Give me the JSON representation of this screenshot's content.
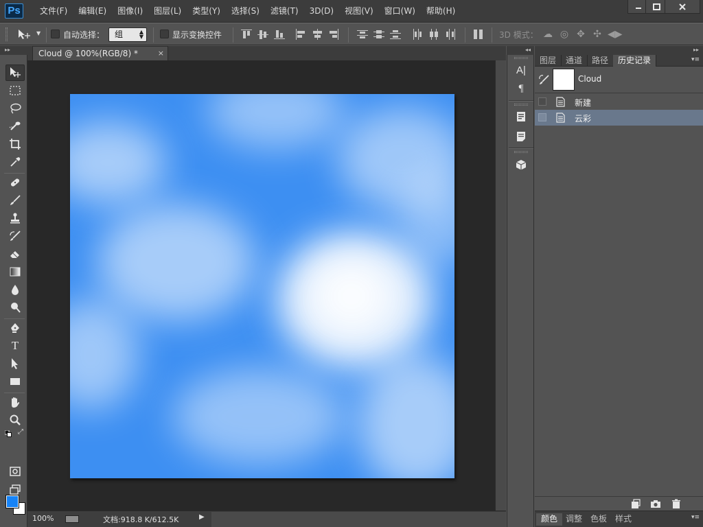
{
  "app": {
    "logo": "Ps",
    "menu": [
      "文件(F)",
      "编辑(E)",
      "图像(I)",
      "图层(L)",
      "类型(Y)",
      "选择(S)",
      "滤镜(T)",
      "3D(D)",
      "视图(V)",
      "窗口(W)",
      "帮助(H)"
    ],
    "window_controls": [
      "minimize-icon",
      "maximize-icon",
      "close-icon"
    ]
  },
  "options_bar": {
    "tool_icon": "move-tool-icon",
    "auto_select_label": "自动选择：",
    "auto_select_checked": false,
    "auto_select_target": "组",
    "show_transform_label": "显示变换控件",
    "show_transform_checked": false,
    "mode_3d_label": "3D 模式："
  },
  "document": {
    "tab_title": "Cloud @ 100%(RGB/8) *",
    "close_glyph": "×",
    "canvas_content": "cloud-texture",
    "colors": {
      "sky": "#3d8ff2",
      "cloud": "#ffffff",
      "pasteboard": "#282828"
    }
  },
  "status": {
    "zoom": "100%",
    "doc_info": "文档:918.8 K/612.5K",
    "arrow": "▶"
  },
  "tools": {
    "active": "move-tool",
    "foreground_color": "#1683f7",
    "background_color": "#ffffff"
  },
  "dock": {
    "buttons": [
      "character-icon",
      "paragraph-icon",
      "properties-icon",
      "notes-icon",
      "3d-icon"
    ]
  },
  "history_panel": {
    "tabs": [
      "图层",
      "通道",
      "路径",
      "历史记录"
    ],
    "active_tab": "历史记录",
    "snapshot_name": "Cloud",
    "items": [
      {
        "label": "新建",
        "selected": false
      },
      {
        "label": "云彩",
        "selected": true
      }
    ]
  },
  "bottom_panel": {
    "tabs": [
      "颜色",
      "调整",
      "色板",
      "样式"
    ],
    "active_tab": "颜色"
  }
}
